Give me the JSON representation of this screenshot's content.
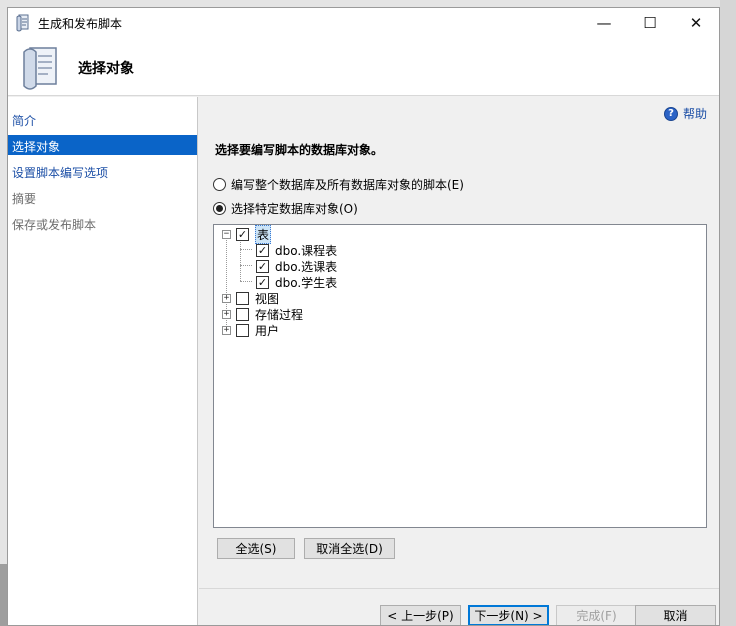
{
  "window": {
    "title": "生成和发布脚本",
    "minimize_glyph": "—",
    "maximize_glyph": "☐",
    "close_glyph": "✕"
  },
  "header": {
    "title": "选择对象",
    "icon": "script-scroll-icon"
  },
  "nav": {
    "items": [
      {
        "label": "简介",
        "state": "link"
      },
      {
        "label": "选择对象",
        "state": "selected"
      },
      {
        "label": "设置脚本编写选项",
        "state": "link"
      },
      {
        "label": "摘要",
        "state": "disabled"
      },
      {
        "label": "保存或发布脚本",
        "state": "disabled"
      }
    ]
  },
  "content": {
    "help_label": "帮助",
    "help_glyph": "?",
    "instruction": "选择要编写脚本的数据库对象。",
    "options": [
      {
        "label": "编写整个数据库及所有数据库对象的脚本(E)",
        "checked": false
      },
      {
        "label": "选择特定数据库对象(O)",
        "checked": true
      }
    ],
    "tree": {
      "expand_glyph": "+",
      "collapse_glyph": "−",
      "check_glyph": "✓",
      "nodes": [
        {
          "label": "表",
          "checked": true,
          "expanded": true,
          "children": [
            {
              "label": "dbo.课程表",
              "checked": true
            },
            {
              "label": "dbo.选课表",
              "checked": true
            },
            {
              "label": "dbo.学生表",
              "checked": true
            }
          ]
        },
        {
          "label": "视图",
          "checked": false,
          "expanded": false
        },
        {
          "label": "存储过程",
          "checked": false,
          "expanded": false
        },
        {
          "label": "用户",
          "checked": false,
          "expanded": false
        }
      ]
    },
    "select_all_label": "全选(S)",
    "deselect_all_label": "取消全选(D)"
  },
  "footer": {
    "prev_label": "< 上一步(P)",
    "next_label": "下一步(N) >",
    "finish_label": "完成(F)",
    "cancel_label": "取消"
  }
}
